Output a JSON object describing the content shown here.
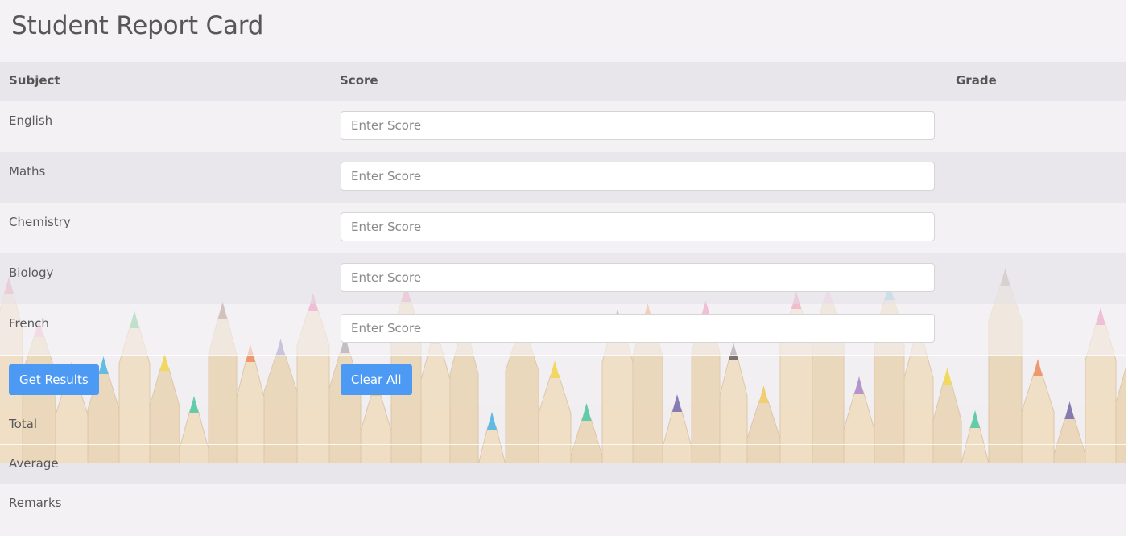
{
  "title": "Student Report Card",
  "table": {
    "headers": {
      "subject": "Subject",
      "score": "Score",
      "grade": "Grade"
    },
    "rows": [
      {
        "subject": "English",
        "score_value": "",
        "score_placeholder": "Enter Score",
        "grade": ""
      },
      {
        "subject": "Maths",
        "score_value": "",
        "score_placeholder": "Enter Score",
        "grade": ""
      },
      {
        "subject": "Chemistry",
        "score_value": "",
        "score_placeholder": "Enter Score",
        "grade": ""
      },
      {
        "subject": "Biology",
        "score_value": "",
        "score_placeholder": "Enter Score",
        "grade": ""
      },
      {
        "subject": "French",
        "score_value": "",
        "score_placeholder": "Enter Score",
        "grade": ""
      }
    ]
  },
  "actions": {
    "get_results_label": "Get Results",
    "clear_all_label": "Clear All"
  },
  "summary": {
    "total_label": "Total",
    "average_label": "Average",
    "remarks_label": "Remarks"
  },
  "colors": {
    "button": "#4d9af5",
    "header_band": "#e8e5ea",
    "page_background": "#f1eff2"
  },
  "background_image": "colored-pencils-image"
}
